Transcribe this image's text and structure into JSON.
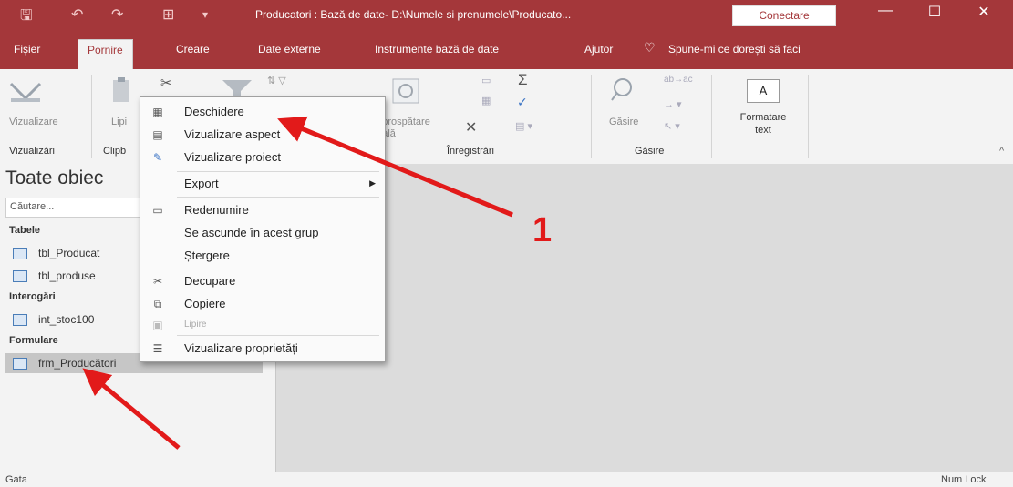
{
  "window": {
    "title": "Producatori : Bază de date- D:\\Numele si prenumele\\Producato...",
    "connect_label": "Conectare",
    "minimize": "—",
    "restore": "☐",
    "close": "✕"
  },
  "menubar": {
    "tabs": [
      {
        "label": "Fișier"
      },
      {
        "label": "Pornire"
      },
      {
        "label": "Creare"
      },
      {
        "label": "Date externe"
      },
      {
        "label": "Instrumente bază de date"
      },
      {
        "label": "Ajutor"
      }
    ],
    "tell_me": "Spune-mi ce dorești să faci",
    "active_tab": "Pornire"
  },
  "ribbon": {
    "view_button": "Vizualizare",
    "paste_button": "Lipi",
    "refresh_button": "împrospătare totală",
    "find_button": "Găsire",
    "text_format_button": "Formatare text",
    "groups": {
      "views": "Vizualizări",
      "clipboard": "Clipb",
      "records": "Înregistrări",
      "find": "Găsire"
    },
    "icons": {
      "sum": "Σ",
      "delete": "✕",
      "text_A": "A"
    }
  },
  "nav": {
    "title": "Toate obiec",
    "search_placeholder": "Căutare...",
    "sections": [
      {
        "header": "Tabele",
        "items": [
          "tbl_Producat",
          "tbl_produse"
        ]
      },
      {
        "header": "Interogări",
        "items": [
          "int_stoc100"
        ]
      },
      {
        "header": "Formulare",
        "items": [
          "frm_Producători"
        ]
      }
    ]
  },
  "context_menu": {
    "items": {
      "open": "Deschidere",
      "layout": "Vizualizare aspect",
      "design": "Vizualizare proiect",
      "export": "Export",
      "rename": "Redenumire",
      "hide": "Se ascunde în acest grup",
      "delete": "Ștergere",
      "cut": "Decupare",
      "copy": "Copiere",
      "paste": "Lipire",
      "properties": "Vizualizare proprietăți"
    }
  },
  "status": {
    "left": "Gata",
    "right": "Num Lock"
  },
  "annotation": {
    "label": "1",
    "arrow_color": "#e21a1a"
  },
  "colors": {
    "accent": "#a4373a",
    "ribbon_bg": "#f3f3f3",
    "workspace_bg": "#dcdcdc"
  }
}
